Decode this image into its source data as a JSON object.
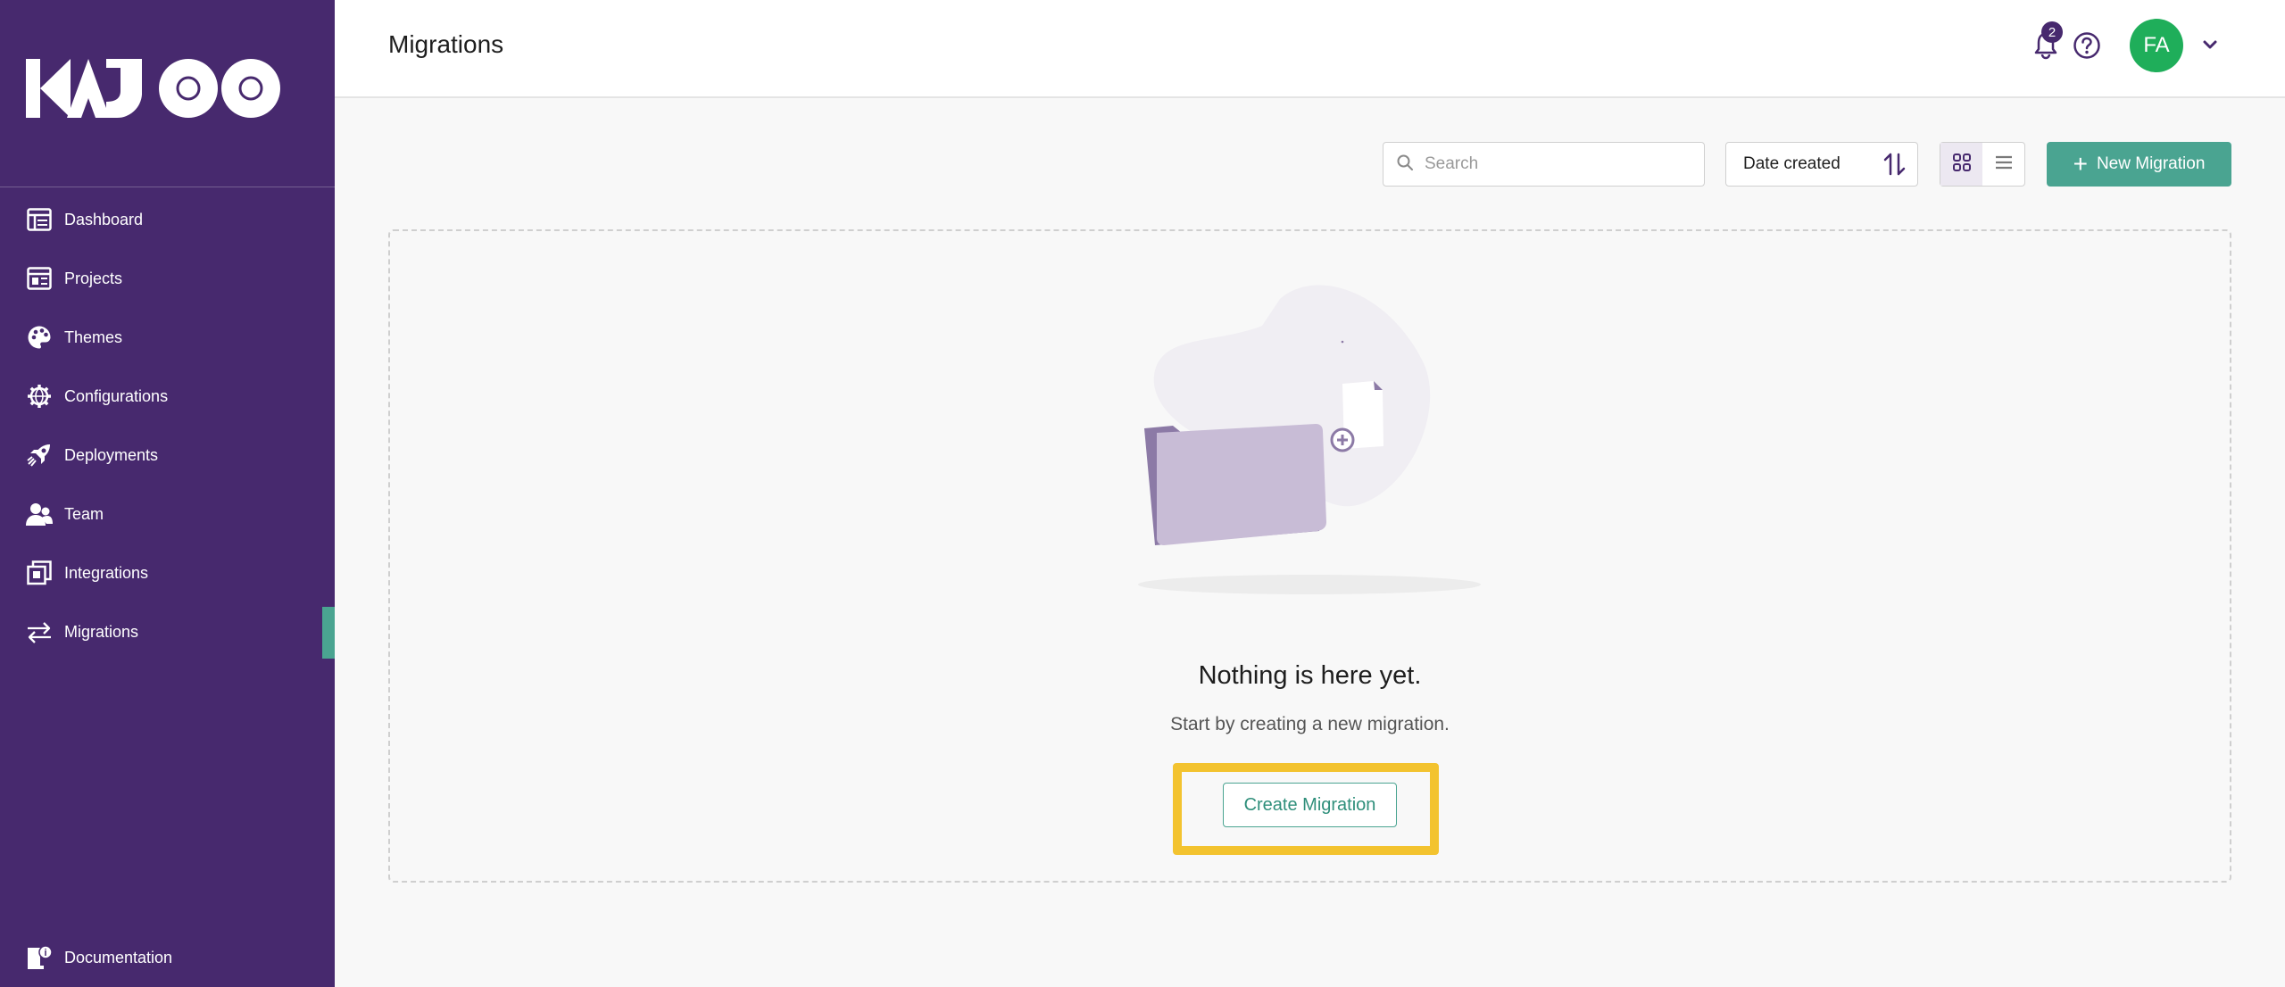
{
  "app": {
    "brand": "KAJOO",
    "colors": {
      "sidebar": "#47296e",
      "accent": "#4aa491",
      "highlight": "#f3c32f",
      "avatar": "#1fae5a"
    }
  },
  "sidebar": {
    "items": [
      {
        "label": "Dashboard",
        "icon": "dashboard-icon"
      },
      {
        "label": "Projects",
        "icon": "projects-icon"
      },
      {
        "label": "Themes",
        "icon": "palette-icon"
      },
      {
        "label": "Configurations",
        "icon": "gear-globe-icon"
      },
      {
        "label": "Deployments",
        "icon": "rocket-icon"
      },
      {
        "label": "Team",
        "icon": "team-icon"
      },
      {
        "label": "Integrations",
        "icon": "integrations-icon"
      },
      {
        "label": "Migrations",
        "icon": "swap-arrows-icon",
        "active": true
      }
    ],
    "documentation": {
      "label": "Documentation",
      "icon": "documentation-icon"
    }
  },
  "header": {
    "title": "Migrations",
    "notifications_count": "2",
    "avatar_initials": "FA"
  },
  "toolbar": {
    "search_placeholder": "Search",
    "sort_label": "Date created",
    "view_mode": "grid",
    "new_button_label": "New Migration"
  },
  "empty_state": {
    "title": "Nothing is here yet.",
    "subtitle": "Start by creating a new migration.",
    "button_label": "Create Migration"
  }
}
